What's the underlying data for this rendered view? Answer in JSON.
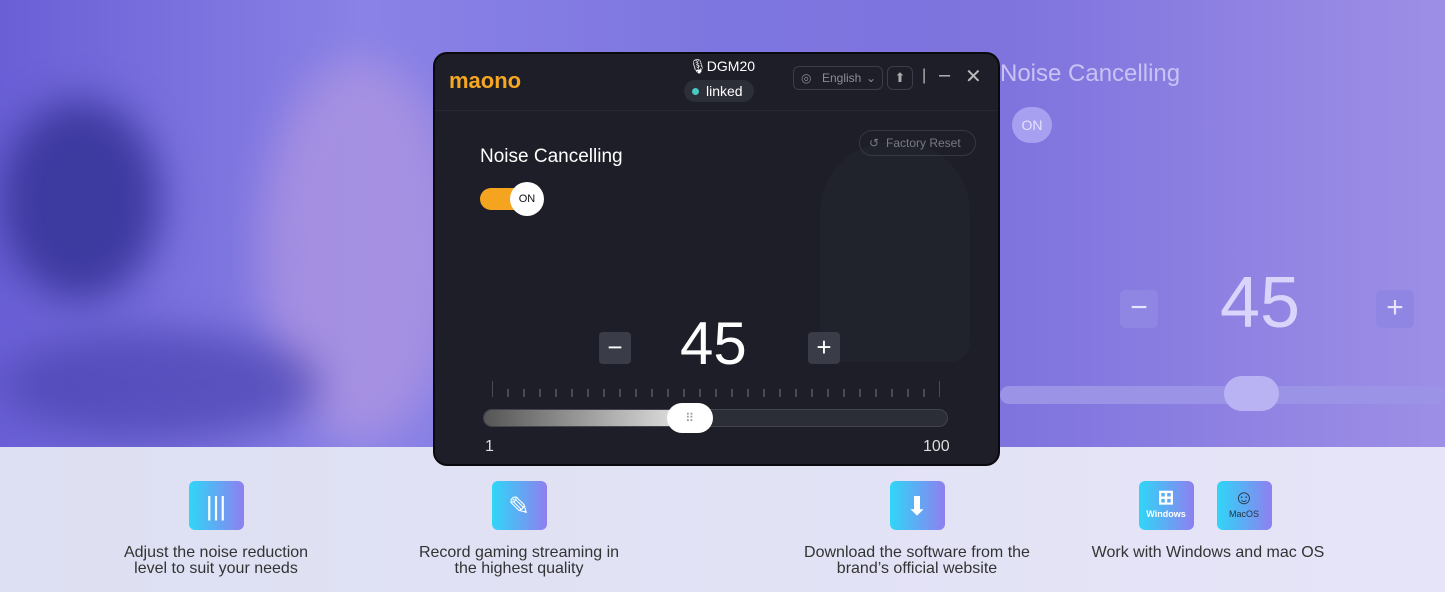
{
  "background": {
    "title": "Noise Cancelling",
    "toggle": "ON",
    "level": "45",
    "minus": "−",
    "plus": "+"
  },
  "window": {
    "logo": "maono",
    "device": "DGM20",
    "status": "linked",
    "language": "English",
    "factory_reset": "Factory Reset",
    "section_title": "Noise Cancelling",
    "toggle_label": "ON",
    "toggle_on": true,
    "level": "45",
    "minus": "−",
    "plus": "+",
    "slider_min": "1",
    "slider_max": "100",
    "slider_value": 45,
    "accent": "#f5a41f"
  },
  "features": [
    {
      "line1": "Adjust the noise reduction",
      "line2": "level to suit your needs",
      "icon": "waveform-icon"
    },
    {
      "line1": "Record gaming streaming in",
      "line2": "the highest quality",
      "icon": "pen-icon"
    },
    {
      "line1": "Download the software from the",
      "line2": "brand’s official website",
      "icon": "download-icon"
    },
    {
      "line1": "Work with  Windows and mac OS",
      "line2": "",
      "icon": "os-icons",
      "windows": "Windows",
      "mac": "MacOS"
    }
  ]
}
